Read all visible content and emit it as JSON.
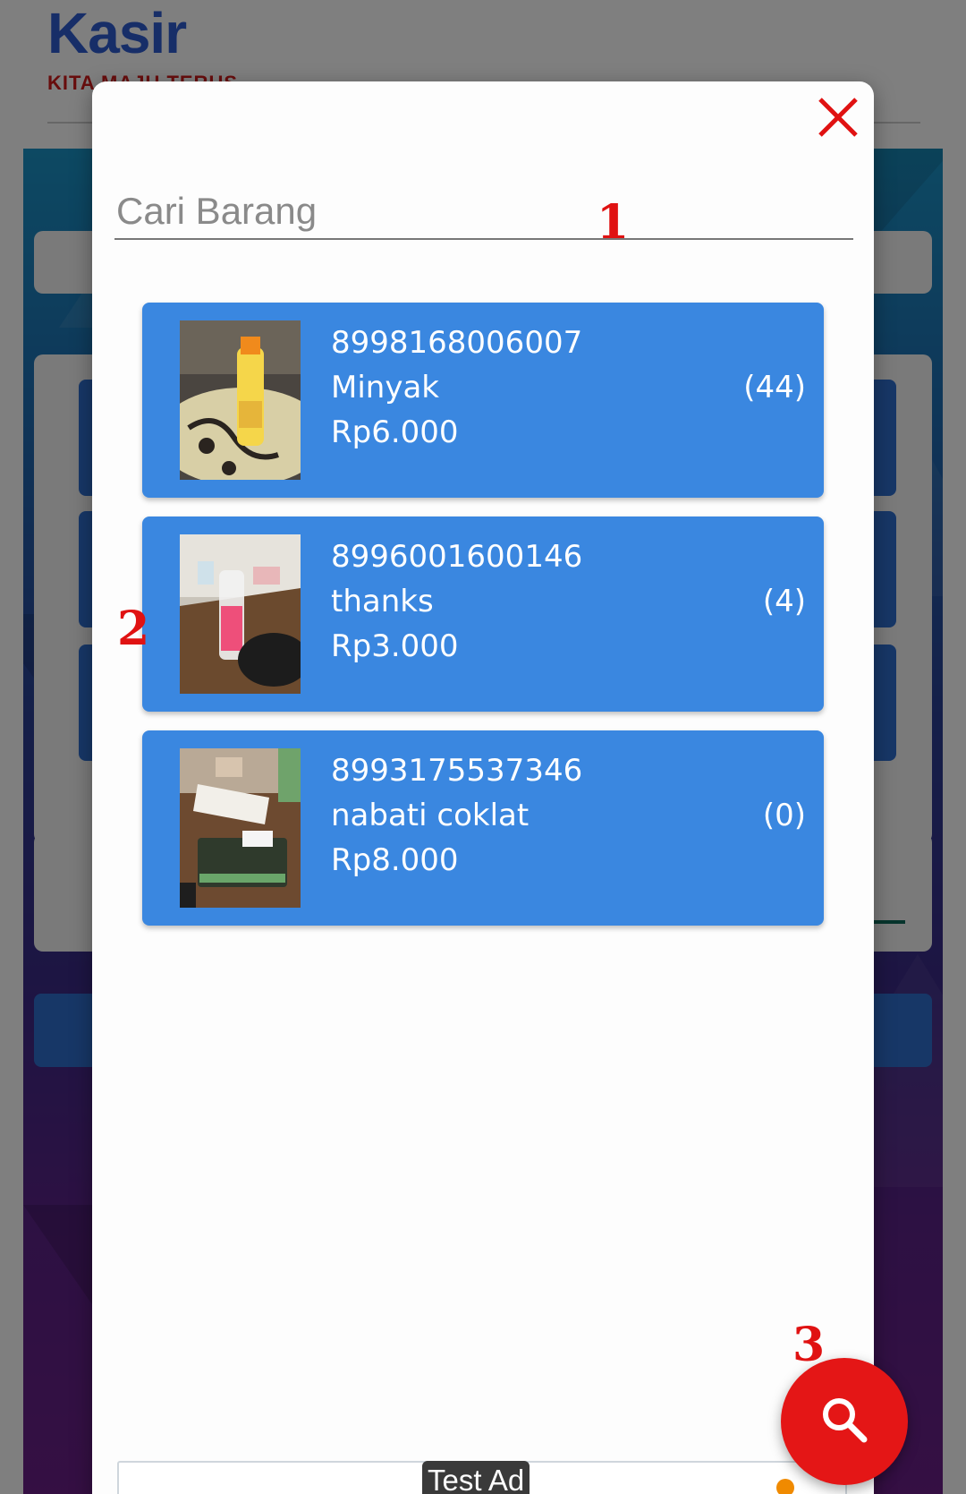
{
  "app": {
    "title": "Kasir",
    "subtitle": "KITA MAJU TERUS"
  },
  "modal": {
    "search": {
      "placeholder": "Cari Barang",
      "value": ""
    },
    "close_icon": "close-icon",
    "items": [
      {
        "barcode": "8998168006007",
        "name": "Minyak",
        "price": "Rp6.000",
        "stock": "(44)"
      },
      {
        "barcode": "8996001600146",
        "name": "thanks",
        "price": "Rp3.000",
        "stock": "(4)"
      },
      {
        "barcode": "8993175537346",
        "name": "nabati coklat",
        "price": "Rp8.000",
        "stock": "(0)"
      }
    ]
  },
  "fab": {
    "icon": "search-icon"
  },
  "ad": {
    "label": "Test Ad"
  },
  "annotations": {
    "m1": "1",
    "m2": "2",
    "m3": "3"
  },
  "colors": {
    "accent": "#3a87e0",
    "brand_blue": "#2f5dd1",
    "brand_red": "#d11a1a",
    "fab_red": "#e41616",
    "close_red": "#e01212"
  }
}
